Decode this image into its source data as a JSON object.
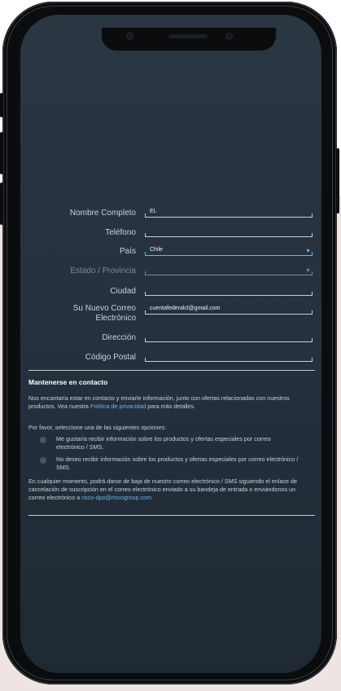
{
  "form": {
    "nombre": {
      "label": "Nombre Completo",
      "value": "EL"
    },
    "telefono": {
      "label": "Teléfono",
      "value": ""
    },
    "pais": {
      "label": "País",
      "value": "Chile"
    },
    "estado": {
      "label": "Estado / Provincia",
      "value": ""
    },
    "ciudad": {
      "label": "Ciudad",
      "value": ""
    },
    "correo": {
      "label_line1": "Su Nuevo Correo",
      "label_line2": "Electrónico",
      "value": "cuentafederalcl@gmail.com"
    },
    "direccion": {
      "label": "Dirección",
      "value": ""
    },
    "postal": {
      "label": "Código Postal",
      "value": ""
    }
  },
  "contact": {
    "title": "Mantenerse en contacto",
    "intro_1": "Nos encantaría estar en contacto y enviarle información, junto con ofertas relacionadas con nuestros productos. Vea nuestra ",
    "privacy_link": "Política de privacidad",
    "intro_2": " para más detalles.",
    "prompt": "Por favor, seleccione una de las siguientes opciones:",
    "option_yes": "Me gustaría recibir información sobre los productos y ofertas especiales por correo electrónico / SMS.",
    "option_no": "No deseo recibir información sobre los productos y ofertas especiales por correo electrónico / SMS.",
    "footer_1": "En cualquier momento, podrá darse de baja de nuestro correo electrónico / SMS siguiendo el enlace de cancelación de suscripción en el correo electrónico enviado a su bandeja de entrada o enviándonos un correo electrónico a ",
    "email_link": "risco-dpo@riscogroup.com"
  }
}
